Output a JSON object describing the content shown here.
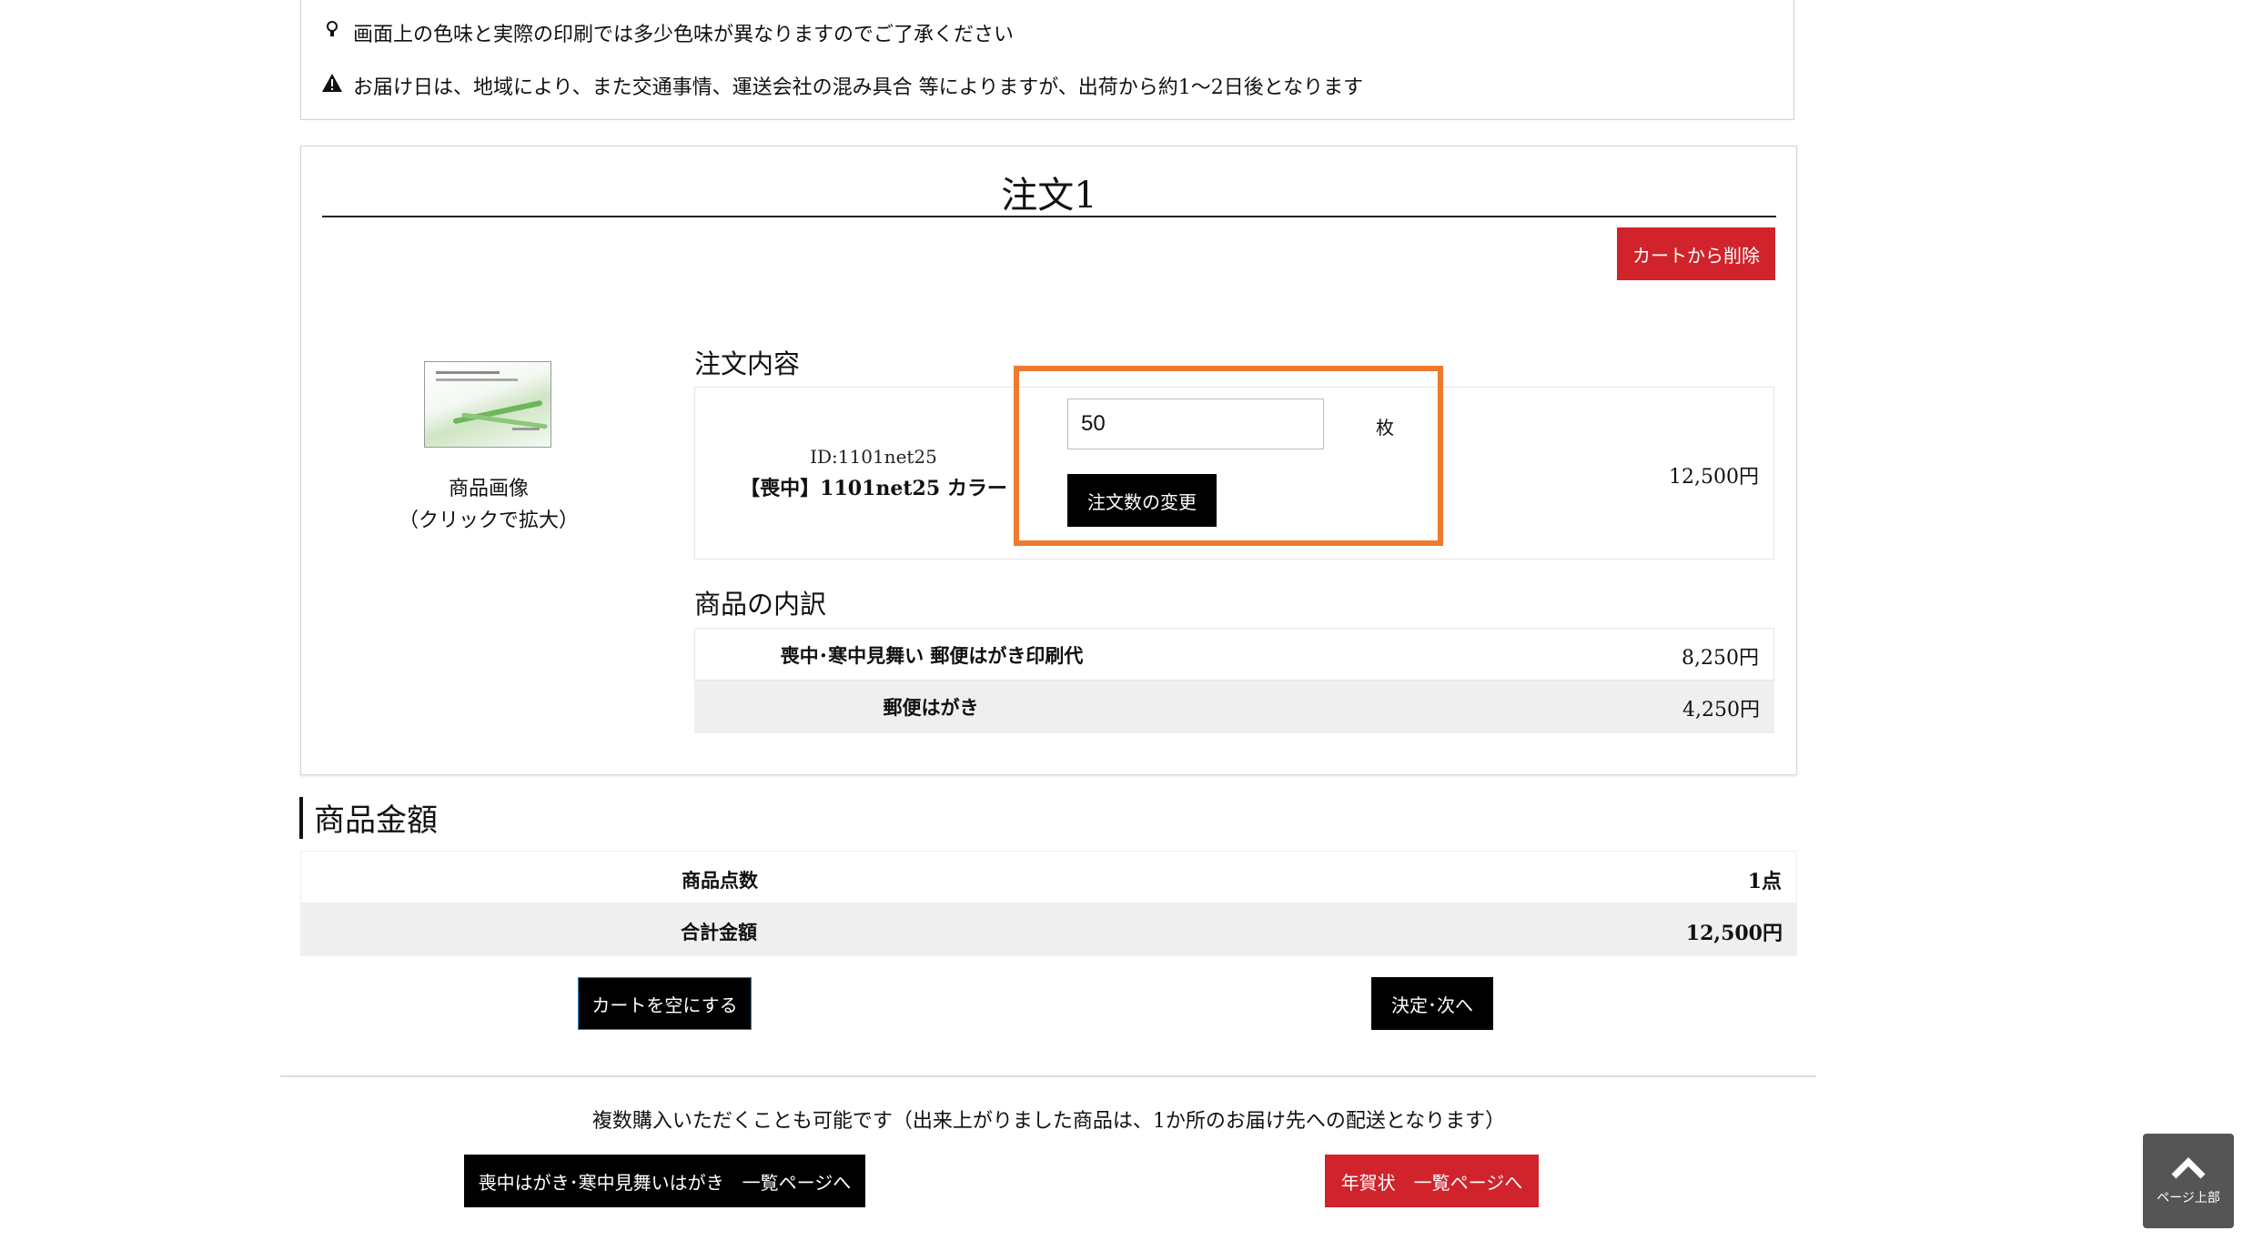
{
  "notices": [
    {
      "icon": "lightbulb-icon",
      "text": "画面上の色味と実際の印刷では多少色味が異なりますのでご了承ください"
    },
    {
      "icon": "warning-icon",
      "text": "お届け日は、地域により、また交通事情、運送会社の混み具合 等によりますが、出荷から約1～2日後となります"
    }
  ],
  "order": {
    "title": "注文1",
    "remove_button": "カートから削除",
    "image_caption_1": "商品画像",
    "image_caption_2": "（クリックで拡大）",
    "contents_heading": "注文内容",
    "item_id": "ID:1101net25",
    "item_name": "【喪中】1101net25 カラー",
    "quantity_value": "50",
    "quantity_unit": "枚",
    "change_quantity_button": "注文数の変更",
    "item_price": "12,500円",
    "breakdown_heading": "商品の内訳",
    "breakdown": [
      {
        "label": "喪中･寒中見舞い 郵便はがき印刷代",
        "value": "8,250円"
      },
      {
        "label": "郵便はがき",
        "value": "4,250円"
      }
    ]
  },
  "amount": {
    "heading": "商品金額",
    "rows": [
      {
        "label": "商品点数",
        "value": "1点"
      },
      {
        "label": "合計金額",
        "value": "12,500円"
      }
    ],
    "empty_cart_button": "カートを空にする",
    "next_button": "決定･次へ"
  },
  "footer": {
    "multi_purchase_note": "複数購入いただくことも可能です（出来上がりました商品は、1か所のお届け先への配送となります）",
    "mourning_list_button": "喪中はがき･寒中見舞いはがき　一覧ページへ",
    "new_year_list_button": "年賀状　一覧ページへ"
  },
  "page_top": {
    "label": "ページ上部"
  },
  "colors": {
    "accent_red": "#d0232b",
    "highlight_orange": "#ee7a2d",
    "black": "#000000"
  }
}
